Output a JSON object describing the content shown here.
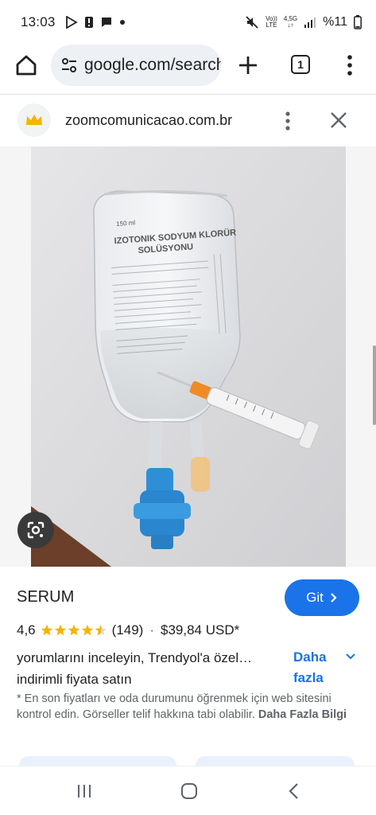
{
  "status_bar": {
    "time": "13:03",
    "volte_top": "Vo))",
    "volte_bottom": "LTE",
    "network_type": "4,5G",
    "battery_text": "%11"
  },
  "browser": {
    "url": "google.com/search",
    "tab_count": "1"
  },
  "panel": {
    "site_name": "zoomcomunicacao.com.br"
  },
  "bag_label": {
    "volume": "150 ml",
    "title_line1": "IZOTONIK SODYUM KLORÜR",
    "title_line2": "SOLÜSYONU"
  },
  "product": {
    "title": "SERUM",
    "visit_label": "Git",
    "rating": "4,6",
    "stars_filled": 4.5,
    "review_count": "(149)",
    "separator": "·",
    "price": "$39,84 USD*",
    "description_line1": "yorumlarını inceleyin, Trendyol'a özel…",
    "description_line2": "indirimli fiyata satın",
    "more_label_line1": "Daha",
    "more_label_line2": "fazla",
    "disclaimer_text": "* En son fiyatları ve oda durumunu öğrenmek için web sitesini kontrol edin. Görseller telif hakkına tabi olabilir.",
    "disclaimer_link": "Daha Fazla Bilgi"
  },
  "colors": {
    "accent": "#1a73e8",
    "star": "#f4b400",
    "syringe_cap": "#f08a24",
    "port_blue": "#2f8fd6"
  }
}
